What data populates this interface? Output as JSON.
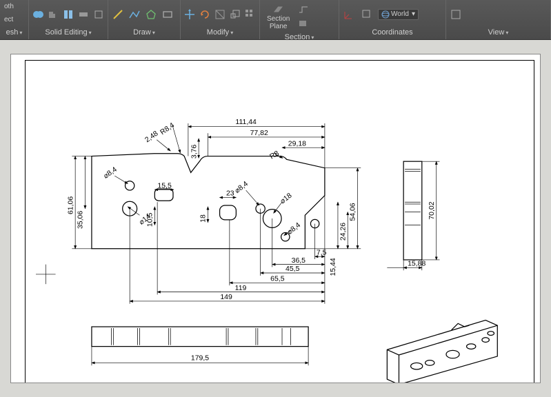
{
  "ribbon": {
    "group_partial_left": {
      "line1": "oth",
      "line2": "ect",
      "dropdown": "esh"
    },
    "group_solid_editing": {
      "label": "Solid Editing"
    },
    "group_draw": {
      "label": "Draw"
    },
    "group_modify": {
      "label": "Modify"
    },
    "group_section": {
      "label": "Section",
      "big_button": "Section\nPlane"
    },
    "group_coordinates": {
      "label": "Coordinates",
      "world": "World"
    },
    "group_view": {
      "label": "View"
    }
  },
  "drawing": {
    "dimensions": {
      "d111_44": "111,44",
      "d77_82": "77,82",
      "d29_18": "29,18",
      "d2_48": "2,48",
      "d3_76": "3,76",
      "r8_4": "R8,4",
      "r8": "R8",
      "dia8_4": "⌀8,4",
      "d15_5": "15,5",
      "dia14": "⌀14",
      "d10_5": "10,5",
      "d18_v": "18",
      "d23": "23",
      "dia8_4b": "⌀8,4",
      "dia18": "⌀18",
      "dia8_4c": "⌀8,4",
      "d35_06": "35,06",
      "d61_06": "61,06",
      "d54_06": "54,06",
      "d24_26": "24,26",
      "d15_44": "15,44",
      "d70_02": "70,02",
      "d15_88": "15,88",
      "d7_5": "7,5",
      "d36_5": "36,5",
      "d45_5": "45,5",
      "d65_5": "65,5",
      "d119": "119",
      "d149": "149",
      "d179_5": "179,5"
    }
  }
}
